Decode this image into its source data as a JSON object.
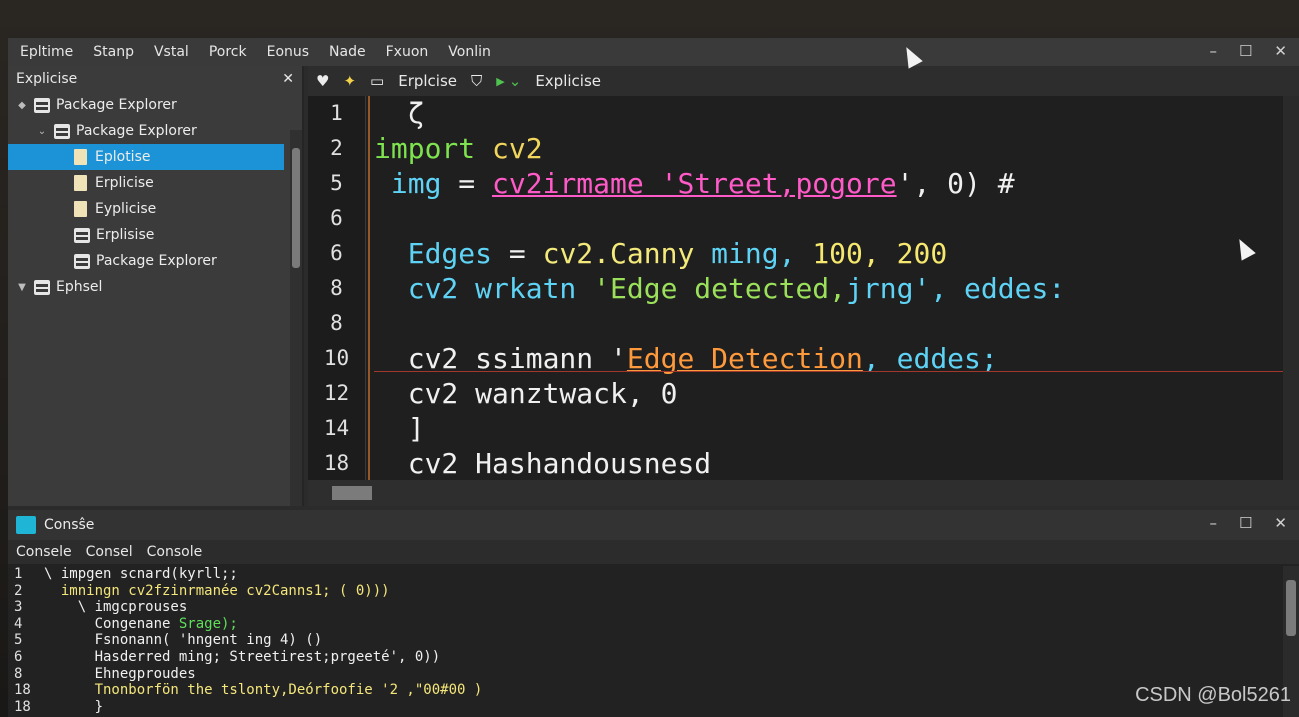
{
  "menu": [
    "Epltime",
    "Stanp",
    "Vstal",
    "Porck",
    "Eonus",
    "Nade",
    "Fxuon",
    "Vonlin"
  ],
  "window_controls": [
    "–",
    "☐",
    "✕"
  ],
  "explorer": {
    "title": "Explicise",
    "close": "✕",
    "items": [
      {
        "label": "Package Explorer",
        "twisty": "◆",
        "icon": "package-icon",
        "indent": 0
      },
      {
        "label": "Package Explorer",
        "twisty": "⌄",
        "icon": "package-icon",
        "indent": 1
      },
      {
        "label": "Eplotise",
        "icon": "file-icon",
        "indent": 2,
        "selected": true
      },
      {
        "label": "Erplicise",
        "icon": "file-icon",
        "indent": 2
      },
      {
        "label": "Eyplicise",
        "icon": "file-icon",
        "indent": 2
      },
      {
        "label": "Erplisise",
        "icon": "package-icon",
        "indent": 2
      },
      {
        "label": "Package Explorer",
        "icon": "package-icon",
        "indent": 2
      },
      {
        "label": "Ephsel",
        "twisty": "▼",
        "icon": "package-icon",
        "indent": 0
      }
    ]
  },
  "editor": {
    "toolbar": {
      "heart": "♥",
      "spark": "✦",
      "screen": "▭",
      "tab1": "Erplcise",
      "cup": "⛉",
      "play": "▶",
      "chevron": "⌄",
      "tab2": "Explicise"
    },
    "line_numbers": [
      "1",
      "2",
      "5",
      "6",
      "6",
      "8",
      "8",
      "10",
      "12",
      "14",
      "18"
    ],
    "code": [
      {
        "indent": "  ",
        "parts": [
          {
            "t": "ζ",
            "c": "plain"
          }
        ]
      },
      {
        "indent": "",
        "parts": [
          {
            "t": "import ",
            "c": "kw"
          },
          {
            "t": "cv2",
            "c": "mod"
          }
        ]
      },
      {
        "indent": " ",
        "parts": [
          {
            "t": "img",
            "c": "var"
          },
          {
            "t": " = ",
            "c": "plain"
          },
          {
            "t": "cv2irmame 'Street,pogore",
            "c": "str"
          },
          {
            "t": "', 0) #",
            "c": "plain"
          }
        ]
      },
      {
        "indent": "",
        "parts": []
      },
      {
        "indent": "  ",
        "parts": [
          {
            "t": "Edges",
            "c": "var"
          },
          {
            "t": " = ",
            "c": "plain"
          },
          {
            "t": "cv2.Canny",
            "c": "fn"
          },
          {
            "t": " ming, ",
            "c": "var"
          },
          {
            "t": "100, 200",
            "c": "num"
          }
        ]
      },
      {
        "indent": "  ",
        "parts": [
          {
            "t": "cv2 wrkatn ",
            "c": "var"
          },
          {
            "t": "'Edge detected,",
            "c": "str2"
          },
          {
            "t": "jrng'",
            "c": "var"
          },
          {
            "t": ", eddes:",
            "c": "var"
          }
        ]
      },
      {
        "indent": "",
        "parts": []
      },
      {
        "indent": "  ",
        "parts": [
          {
            "t": "cv2 ssimann '",
            "c": "plain"
          },
          {
            "t": "Edge Detection",
            "c": "str3"
          },
          {
            "t": ", eddes;",
            "c": "var"
          }
        ]
      },
      {
        "indent": "  ",
        "parts": [
          {
            "t": "cv2 wanztwack, 0",
            "c": "plain"
          }
        ]
      },
      {
        "indent": "  ",
        "parts": [
          {
            "t": "]",
            "c": "plain"
          }
        ]
      },
      {
        "indent": "  ",
        "parts": [
          {
            "t": "cv2 Hashandousnesd",
            "c": "plain"
          }
        ]
      }
    ]
  },
  "console": {
    "title": "Consŝe",
    "tabs": [
      "Consele",
      "Consel",
      "Console"
    ],
    "controls": [
      "–",
      "☐",
      "✕"
    ],
    "lines": [
      {
        "n": "1",
        "text": "\\ impgen scnard(kyrll;;",
        "style": "plain"
      },
      {
        "n": "2",
        "text": "  imningn cv2fzinrmanée cv2Canns1; ( 0)))",
        "style": "yellow"
      },
      {
        "n": "3",
        "text": "    \\ imgcprouses",
        "style": "plain"
      },
      {
        "n": "4",
        "text": "      Congenane ",
        "style": "plain",
        "green": "Srage);"
      },
      {
        "n": "5",
        "text": "      Fsnonann( 'hngent ing 4) ()",
        "style": "plain"
      },
      {
        "n": "6",
        "text": "      Hasderred ming; Streetirest;prgeeté', 0))",
        "style": "plain"
      },
      {
        "n": "8",
        "text": "      Ehnegproudes",
        "style": "plain"
      },
      {
        "n": "18",
        "text": "      Tnonborfön the tslonty,Deórfoofie '2 ,\"00#00 )",
        "style": "yellow"
      },
      {
        "n": "18",
        "text": "      }",
        "style": "plain"
      }
    ]
  },
  "watermark": "CSDN @Bol5261"
}
